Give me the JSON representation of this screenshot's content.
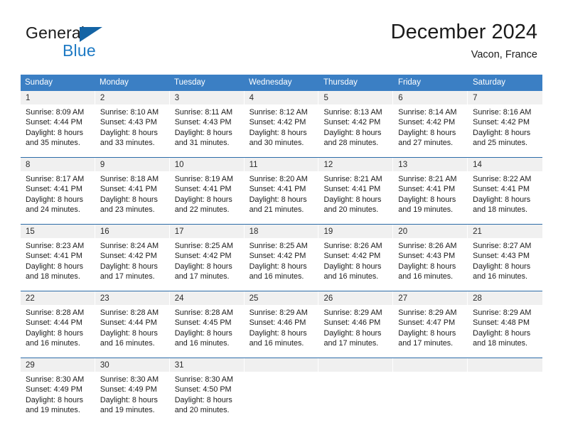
{
  "brand": {
    "name_part1": "General",
    "name_part2": "Blue",
    "accent_color": "#1e7ac4",
    "triangle_color": "#1464a5"
  },
  "header": {
    "title": "December 2024",
    "subtitle": "Vacon, France",
    "header_bg_color": "#3b7fc4",
    "header_text_color": "#ffffff",
    "week_divider_color": "#2d6ca8",
    "daynum_band_color": "#f0f0f0"
  },
  "weekdays": [
    "Sunday",
    "Monday",
    "Tuesday",
    "Wednesday",
    "Thursday",
    "Friday",
    "Saturday"
  ],
  "weeks": [
    [
      {
        "day": "1",
        "sunrise": "Sunrise: 8:09 AM",
        "sunset": "Sunset: 4:44 PM",
        "daylight1": "Daylight: 8 hours",
        "daylight2": "and 35 minutes."
      },
      {
        "day": "2",
        "sunrise": "Sunrise: 8:10 AM",
        "sunset": "Sunset: 4:43 PM",
        "daylight1": "Daylight: 8 hours",
        "daylight2": "and 33 minutes."
      },
      {
        "day": "3",
        "sunrise": "Sunrise: 8:11 AM",
        "sunset": "Sunset: 4:43 PM",
        "daylight1": "Daylight: 8 hours",
        "daylight2": "and 31 minutes."
      },
      {
        "day": "4",
        "sunrise": "Sunrise: 8:12 AM",
        "sunset": "Sunset: 4:42 PM",
        "daylight1": "Daylight: 8 hours",
        "daylight2": "and 30 minutes."
      },
      {
        "day": "5",
        "sunrise": "Sunrise: 8:13 AM",
        "sunset": "Sunset: 4:42 PM",
        "daylight1": "Daylight: 8 hours",
        "daylight2": "and 28 minutes."
      },
      {
        "day": "6",
        "sunrise": "Sunrise: 8:14 AM",
        "sunset": "Sunset: 4:42 PM",
        "daylight1": "Daylight: 8 hours",
        "daylight2": "and 27 minutes."
      },
      {
        "day": "7",
        "sunrise": "Sunrise: 8:16 AM",
        "sunset": "Sunset: 4:42 PM",
        "daylight1": "Daylight: 8 hours",
        "daylight2": "and 25 minutes."
      }
    ],
    [
      {
        "day": "8",
        "sunrise": "Sunrise: 8:17 AM",
        "sunset": "Sunset: 4:41 PM",
        "daylight1": "Daylight: 8 hours",
        "daylight2": "and 24 minutes."
      },
      {
        "day": "9",
        "sunrise": "Sunrise: 8:18 AM",
        "sunset": "Sunset: 4:41 PM",
        "daylight1": "Daylight: 8 hours",
        "daylight2": "and 23 minutes."
      },
      {
        "day": "10",
        "sunrise": "Sunrise: 8:19 AM",
        "sunset": "Sunset: 4:41 PM",
        "daylight1": "Daylight: 8 hours",
        "daylight2": "and 22 minutes."
      },
      {
        "day": "11",
        "sunrise": "Sunrise: 8:20 AM",
        "sunset": "Sunset: 4:41 PM",
        "daylight1": "Daylight: 8 hours",
        "daylight2": "and 21 minutes."
      },
      {
        "day": "12",
        "sunrise": "Sunrise: 8:21 AM",
        "sunset": "Sunset: 4:41 PM",
        "daylight1": "Daylight: 8 hours",
        "daylight2": "and 20 minutes."
      },
      {
        "day": "13",
        "sunrise": "Sunrise: 8:21 AM",
        "sunset": "Sunset: 4:41 PM",
        "daylight1": "Daylight: 8 hours",
        "daylight2": "and 19 minutes."
      },
      {
        "day": "14",
        "sunrise": "Sunrise: 8:22 AM",
        "sunset": "Sunset: 4:41 PM",
        "daylight1": "Daylight: 8 hours",
        "daylight2": "and 18 minutes."
      }
    ],
    [
      {
        "day": "15",
        "sunrise": "Sunrise: 8:23 AM",
        "sunset": "Sunset: 4:41 PM",
        "daylight1": "Daylight: 8 hours",
        "daylight2": "and 18 minutes."
      },
      {
        "day": "16",
        "sunrise": "Sunrise: 8:24 AM",
        "sunset": "Sunset: 4:42 PM",
        "daylight1": "Daylight: 8 hours",
        "daylight2": "and 17 minutes."
      },
      {
        "day": "17",
        "sunrise": "Sunrise: 8:25 AM",
        "sunset": "Sunset: 4:42 PM",
        "daylight1": "Daylight: 8 hours",
        "daylight2": "and 17 minutes."
      },
      {
        "day": "18",
        "sunrise": "Sunrise: 8:25 AM",
        "sunset": "Sunset: 4:42 PM",
        "daylight1": "Daylight: 8 hours",
        "daylight2": "and 16 minutes."
      },
      {
        "day": "19",
        "sunrise": "Sunrise: 8:26 AM",
        "sunset": "Sunset: 4:42 PM",
        "daylight1": "Daylight: 8 hours",
        "daylight2": "and 16 minutes."
      },
      {
        "day": "20",
        "sunrise": "Sunrise: 8:26 AM",
        "sunset": "Sunset: 4:43 PM",
        "daylight1": "Daylight: 8 hours",
        "daylight2": "and 16 minutes."
      },
      {
        "day": "21",
        "sunrise": "Sunrise: 8:27 AM",
        "sunset": "Sunset: 4:43 PM",
        "daylight1": "Daylight: 8 hours",
        "daylight2": "and 16 minutes."
      }
    ],
    [
      {
        "day": "22",
        "sunrise": "Sunrise: 8:28 AM",
        "sunset": "Sunset: 4:44 PM",
        "daylight1": "Daylight: 8 hours",
        "daylight2": "and 16 minutes."
      },
      {
        "day": "23",
        "sunrise": "Sunrise: 8:28 AM",
        "sunset": "Sunset: 4:44 PM",
        "daylight1": "Daylight: 8 hours",
        "daylight2": "and 16 minutes."
      },
      {
        "day": "24",
        "sunrise": "Sunrise: 8:28 AM",
        "sunset": "Sunset: 4:45 PM",
        "daylight1": "Daylight: 8 hours",
        "daylight2": "and 16 minutes."
      },
      {
        "day": "25",
        "sunrise": "Sunrise: 8:29 AM",
        "sunset": "Sunset: 4:46 PM",
        "daylight1": "Daylight: 8 hours",
        "daylight2": "and 16 minutes."
      },
      {
        "day": "26",
        "sunrise": "Sunrise: 8:29 AM",
        "sunset": "Sunset: 4:46 PM",
        "daylight1": "Daylight: 8 hours",
        "daylight2": "and 17 minutes."
      },
      {
        "day": "27",
        "sunrise": "Sunrise: 8:29 AM",
        "sunset": "Sunset: 4:47 PM",
        "daylight1": "Daylight: 8 hours",
        "daylight2": "and 17 minutes."
      },
      {
        "day": "28",
        "sunrise": "Sunrise: 8:29 AM",
        "sunset": "Sunset: 4:48 PM",
        "daylight1": "Daylight: 8 hours",
        "daylight2": "and 18 minutes."
      }
    ],
    [
      {
        "day": "29",
        "sunrise": "Sunrise: 8:30 AM",
        "sunset": "Sunset: 4:49 PM",
        "daylight1": "Daylight: 8 hours",
        "daylight2": "and 19 minutes."
      },
      {
        "day": "30",
        "sunrise": "Sunrise: 8:30 AM",
        "sunset": "Sunset: 4:49 PM",
        "daylight1": "Daylight: 8 hours",
        "daylight2": "and 19 minutes."
      },
      {
        "day": "31",
        "sunrise": "Sunrise: 8:30 AM",
        "sunset": "Sunset: 4:50 PM",
        "daylight1": "Daylight: 8 hours",
        "daylight2": "and 20 minutes."
      },
      {
        "day": "",
        "sunrise": "",
        "sunset": "",
        "daylight1": "",
        "daylight2": ""
      },
      {
        "day": "",
        "sunrise": "",
        "sunset": "",
        "daylight1": "",
        "daylight2": ""
      },
      {
        "day": "",
        "sunrise": "",
        "sunset": "",
        "daylight1": "",
        "daylight2": ""
      },
      {
        "day": "",
        "sunrise": "",
        "sunset": "",
        "daylight1": "",
        "daylight2": ""
      }
    ]
  ]
}
